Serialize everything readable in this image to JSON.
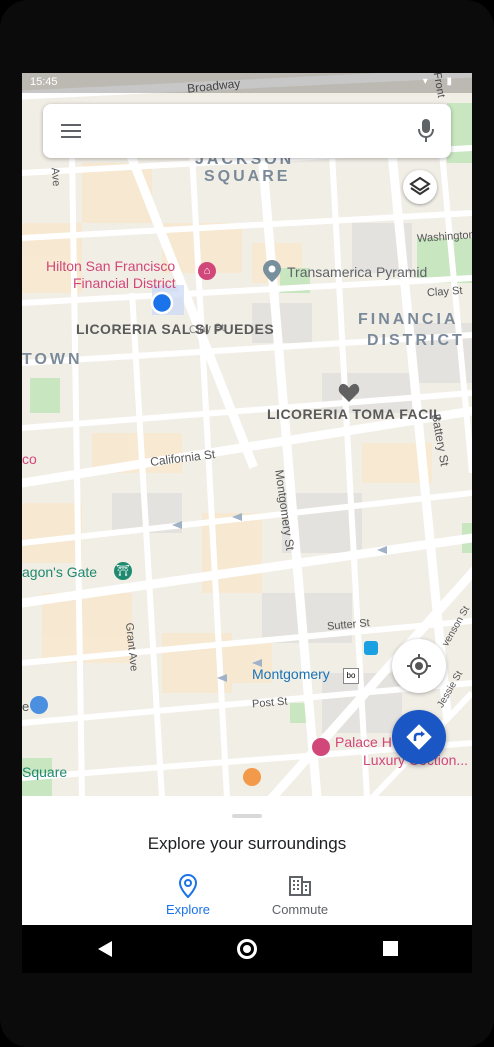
{
  "status": {
    "time": "15:45",
    "icons": "▾ ▮"
  },
  "search": {
    "menu_icon": "menu-icon",
    "mic_icon": "mic-icon"
  },
  "map": {
    "streets": {
      "broadway": "Broadway",
      "california": "California St",
      "montgomery": "Montgomery St",
      "battery": "Battery St",
      "clay": "Clay St",
      "sutter": "Sutter St",
      "post": "Post St",
      "grant": "Grant Ave",
      "washington": "Washington",
      "jessie": "Jessie St",
      "stevenson": "venson St",
      "front": "Front",
      "ave": "Ave"
    },
    "districts": {
      "jackson_square": "JACKSON\nSQUARE",
      "jackson_top": "JACKSON",
      "jackson_bottom": "SQUARE",
      "financial_top": "FINANCIA",
      "financial_bottom": "DISTRICT",
      "chinatown": "TOWN"
    },
    "places": {
      "hilton_line1": "Hilton San Francisco",
      "hilton_line2": "Financial District",
      "transamerica": "Transamerica Pyramid",
      "licoreria_sal": "LICORERIA SAL SI PUEDES",
      "licoreria_toma": "LICORERIA TOMA FACIL",
      "dragons_gate": "agon's Gate",
      "montgomery_station": "Montgomery",
      "palace_line1": "Palace H",
      "palace_line2": "Luxury Co",
      "palace_line2_rest": "ction...",
      "square": "Square",
      "co": "co",
      "e": "e"
    }
  },
  "bottom_sheet": {
    "title": "Explore your surroundings",
    "tabs": [
      {
        "label": "Explore",
        "icon": "location-pin-icon",
        "active": true
      },
      {
        "label": "Commute",
        "icon": "building-icon",
        "active": false
      }
    ]
  },
  "colors": {
    "accent": "#1a73e8",
    "fab": "#1a56c4",
    "poi_pink": "#d2477a"
  }
}
